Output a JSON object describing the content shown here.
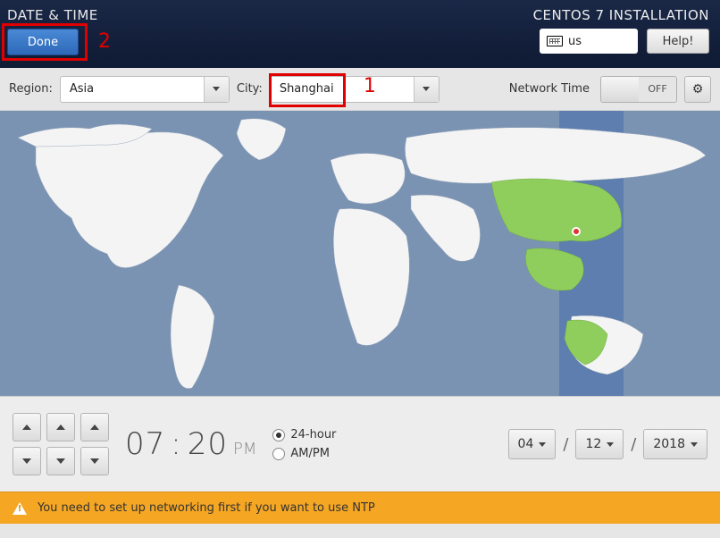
{
  "header": {
    "page_title": "DATE & TIME",
    "done_label": "Done",
    "install_title": "CENTOS 7 INSTALLATION",
    "keyboard_layout": "us",
    "help_label": "Help!"
  },
  "annotations": {
    "marker1": "1",
    "marker2": "2"
  },
  "controls": {
    "region_label": "Region:",
    "region_value": "Asia",
    "city_label": "City:",
    "city_value": "Shanghai",
    "network_time_label": "Network Time",
    "network_time_state": "OFF"
  },
  "map": {
    "selected_city": "Shanghai",
    "timezone": "Asia/Shanghai"
  },
  "time": {
    "hour": "07",
    "minute": "20",
    "ampm": "PM",
    "format_24_label": "24-hour",
    "format_ampm_label": "AM/PM",
    "format_selected": "24-hour"
  },
  "date": {
    "month": "04",
    "day": "12",
    "year": "2018",
    "sep": "/"
  },
  "warning": {
    "text": "You need to set up networking first if you want to use NTP"
  },
  "icons": {
    "gear": "⚙"
  }
}
